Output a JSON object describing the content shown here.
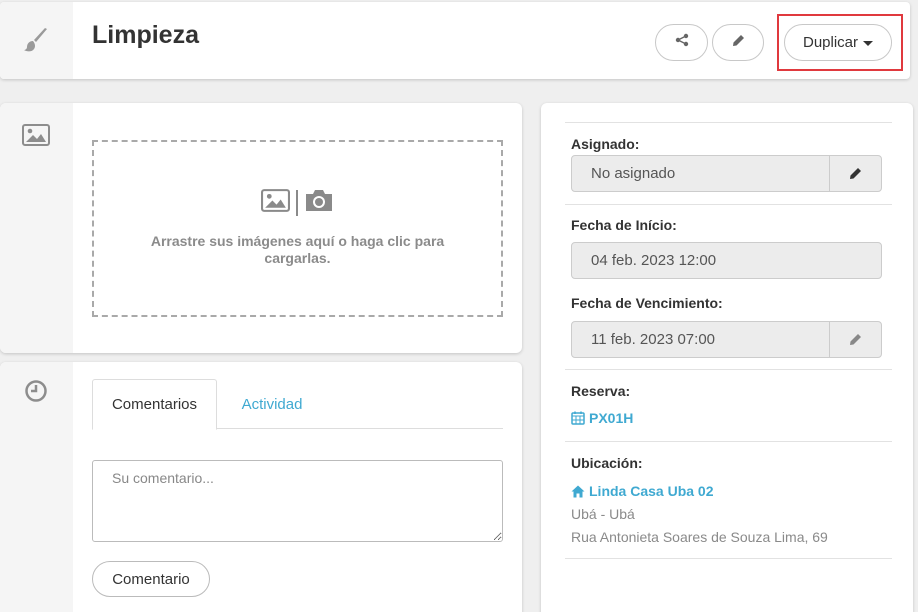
{
  "header": {
    "title": "Limpieza",
    "duplicate_label": "Duplicar",
    "icons": {
      "category": "paintbrush-icon",
      "share": "share-icon",
      "edit": "pencil-icon",
      "caret": "caret-down-icon"
    }
  },
  "images": {
    "dropzone_text": "Arrastre sus imágenes aquí o haga clic para cargarlas.",
    "icons": [
      "image-icon",
      "camera-icon"
    ]
  },
  "comments": {
    "tabs": [
      {
        "label": "Comentarios",
        "active": true
      },
      {
        "label": "Actividad",
        "active": false
      }
    ],
    "placeholder": "Su comentario...",
    "submit_label": "Comentario"
  },
  "details": {
    "assigned": {
      "label": "Asignado:",
      "value": "No asignado"
    },
    "start_date": {
      "label": "Fecha de Início:",
      "value": "04 feb. 2023 12:00"
    },
    "due_date": {
      "label": "Fecha de Vencimiento:",
      "value": "11 feb. 2023 07:00"
    },
    "reservation": {
      "label": "Reserva:",
      "code": "PX01H"
    },
    "location": {
      "label": "Ubicación:",
      "property": "Linda Casa Uba 02",
      "city": "Ubá - Ubá",
      "address": "Rua Antonieta Soares de Souza Lima, 69"
    }
  },
  "colors": {
    "link": "#3fa9d1",
    "highlight": "#e0393e",
    "gutter": "#f5f5f5",
    "background": "#efefef"
  }
}
